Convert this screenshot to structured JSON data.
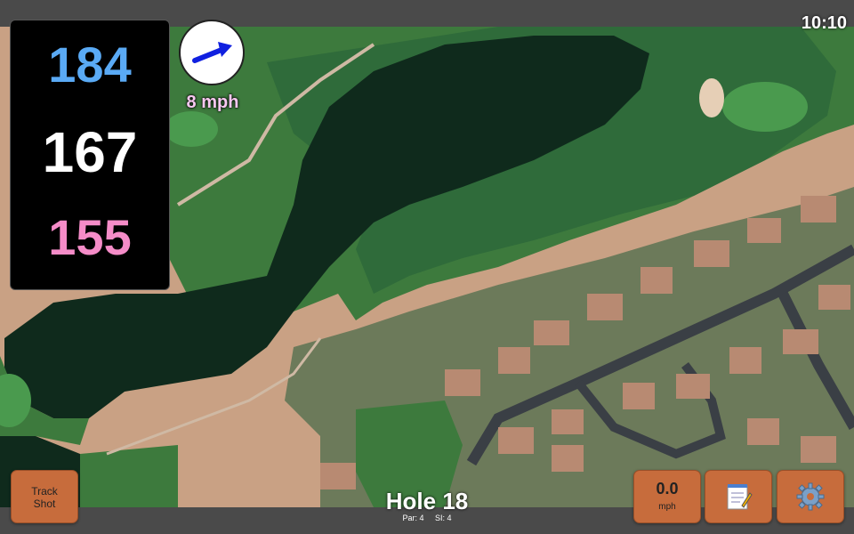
{
  "status_bar": {
    "time": "10:10"
  },
  "distances": {
    "back": "184",
    "middle": "167",
    "front": "155"
  },
  "wind": {
    "speed_label": "8 mph",
    "direction_icon": "arrow-icon"
  },
  "buttons": {
    "track_shot_line1": "Track",
    "track_shot_line2": "Shot",
    "speed_value": "0.0",
    "speed_unit": "mph",
    "notes_icon": "notepad-icon",
    "settings_icon": "gear-icon"
  },
  "hole": {
    "title": "Hole 18",
    "par": "Par: 4",
    "stroke_index": "SI: 4"
  },
  "colors": {
    "back_distance": "#5aaaf5",
    "middle_distance": "#ffffff",
    "front_distance": "#f58cc8",
    "button": "#c76c3c",
    "wind_arrow": "#1020e0"
  }
}
